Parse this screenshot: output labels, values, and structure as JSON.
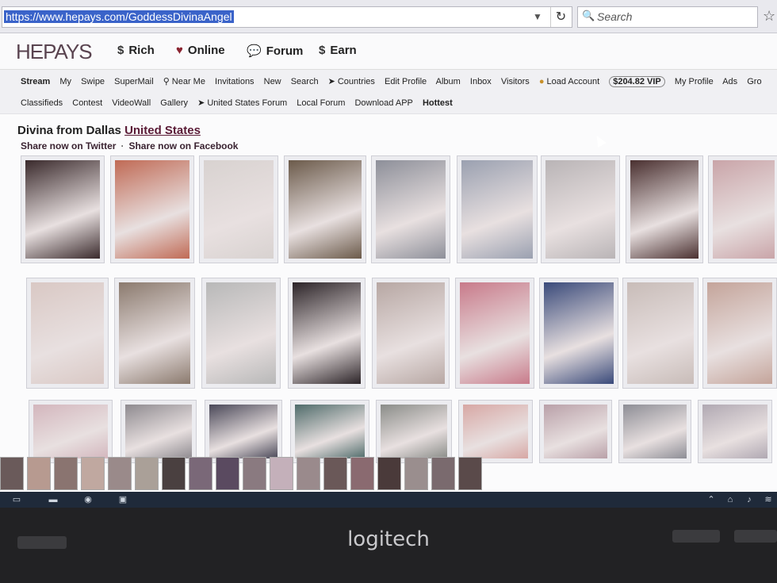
{
  "browser": {
    "url": "https://www.hepays.com/GoddessDivinaAngel",
    "search_placeholder": "Search"
  },
  "site": {
    "logo": "HEPAYS",
    "top_nav": [
      {
        "icon": "dollar-icon",
        "label": "Rich"
      },
      {
        "icon": "heart-icon",
        "label": "Online"
      },
      {
        "icon": "chat-icon",
        "label": "Forum"
      },
      {
        "icon": "dollar-icon",
        "label": "Earn"
      }
    ]
  },
  "subnav": {
    "row1": [
      "Stream",
      "My",
      "Swipe",
      "SuperMail",
      "Near Me",
      "Invitations",
      "New",
      "Search",
      "Countries",
      "Edit Profile",
      "Album",
      "Inbox",
      "Visitors",
      "Load Account",
      "$204.82 VIP",
      "My Profile",
      "Ads",
      "Gro"
    ],
    "row2": [
      "Classifieds",
      "Contest",
      "VideoWall",
      "Gallery",
      "United States Forum",
      "Local Forum",
      "Download APP",
      "Hottest"
    ]
  },
  "profile": {
    "title_prefix": "Divina from Dallas",
    "title_link": "United States",
    "share_twitter": "Share now on Twitter",
    "share_separator": "·",
    "share_facebook": "Share now on Facebook"
  },
  "photos_row1": [
    "#3a2a2c",
    "#c06a55",
    "#d8d2d0",
    "#6b5a4a",
    "#8d8f99",
    "#9aa0b0",
    "#b9b4b6",
    "#4a3030",
    "#c9a4a8"
  ],
  "photos_row2": [
    "#d9c8c4",
    "#8b7a6e",
    "#b8b8b8",
    "#2c2428",
    "#b7a7a3",
    "#c87a8a",
    "#3a4a7a",
    "#c8bcb8",
    "#c4a49a"
  ],
  "photos_row3": [
    "#d3b6bd",
    "#8e8a8f",
    "#4a4858",
    "#4f6b6a",
    "#8a8c88",
    "#d7a7a4",
    "#b9a0a8",
    "#8d8d95",
    "#b0a8b2"
  ],
  "thumbs": [
    "#6a5a5a",
    "#b79a90",
    "#8a7470",
    "#c0a8a0",
    "#9a8a8a",
    "#aaa098",
    "#4a4040",
    "#7a6878",
    "#5a4a60",
    "#8a7a80",
    "#c4b0ba",
    "#9a8a8c",
    "#6a5858",
    "#8a6a70",
    "#4a3a3a",
    "#9a8e8e",
    "#7a6a6e",
    "#5a4a4a"
  ],
  "taskbar_icons": [
    "window-icon",
    "folder-icon",
    "browser-icon",
    "app-icon"
  ],
  "bezel_brand": "logitech",
  "colors": {
    "accent": "#5a1b36",
    "vip": "#222222",
    "selection": "#3a63c9"
  }
}
